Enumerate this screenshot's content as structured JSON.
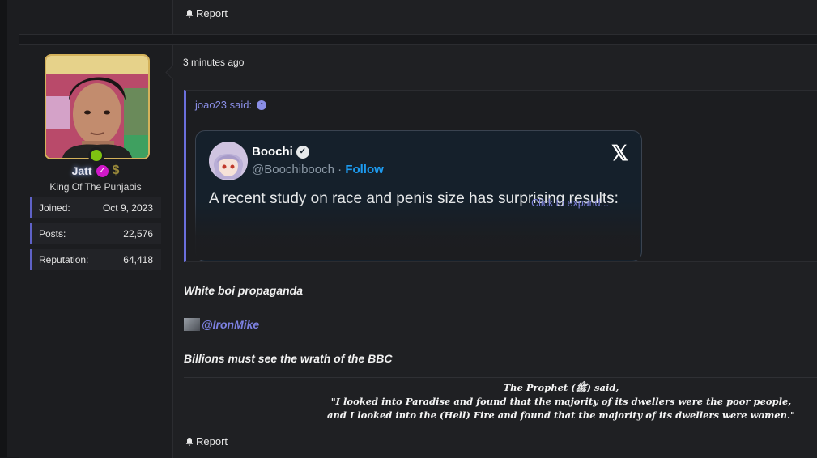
{
  "prev_post": {
    "report_label": "Report"
  },
  "user": {
    "name": "Jatt",
    "title": "King Of The Punjabis",
    "stats": [
      {
        "label": "Joined:",
        "value": "Oct 9, 2023"
      },
      {
        "label": "Posts:",
        "value": "22,576"
      },
      {
        "label": "Reputation:",
        "value": "64,418"
      }
    ]
  },
  "post": {
    "time": "3 minutes ago",
    "quote": {
      "author": "joao23 said:",
      "expand_label": "Click to expand...",
      "tweet": {
        "name": "Boochi",
        "handle": "@Boochibooch",
        "separator": "·",
        "follow_label": "Follow",
        "text": "A recent study on race and penis size has surprising results:",
        "logo": "𝕏"
      }
    },
    "line1": "White boi propaganda",
    "mention": "@IronMike",
    "line2": "Billions must see the wrath of the BBC",
    "signature": {
      "line1": "The Prophet (ﷺ) said,",
      "line2": "\"I looked into Paradise and found that the majority of its dwellers were the poor people,",
      "line3": "and I looked into the (Hell) Fire and found that the majority of its dwellers were women.\""
    },
    "report_label": "Report"
  },
  "colors": {
    "accent": "#6b6fdc",
    "link": "#7c80e0",
    "online": "#7ec211",
    "tweet_bg": "#15202b",
    "follow": "#1d9bf0"
  }
}
